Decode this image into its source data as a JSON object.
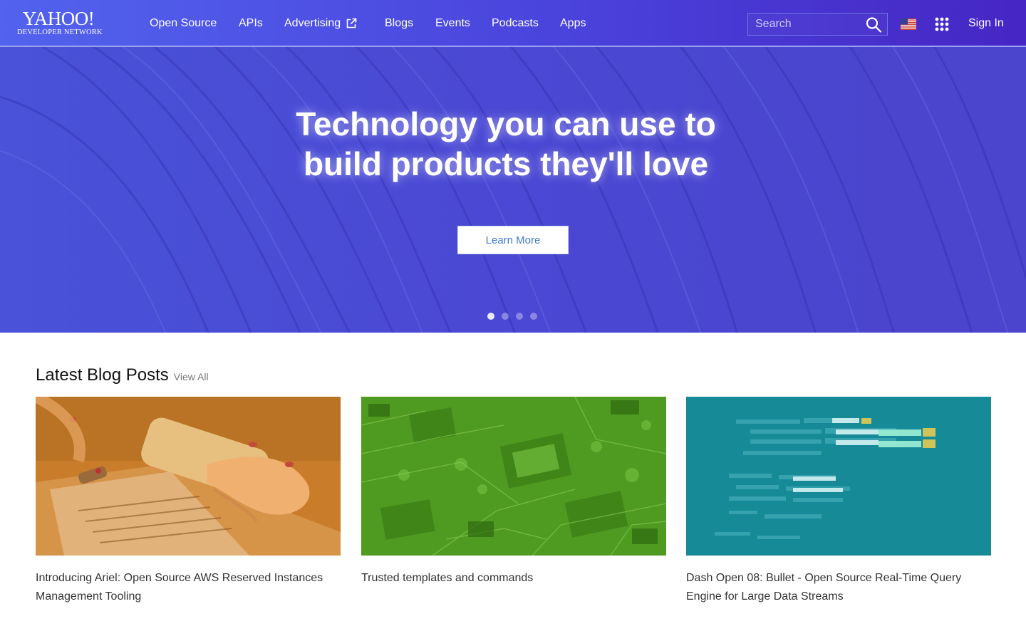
{
  "brand": {
    "logo_main": "YAHOO!",
    "logo_sub": "DEVELOPER NETWORK",
    "primary_color": "#4b4ad2",
    "accent_color": "#3f7ad1"
  },
  "nav": {
    "items": [
      {
        "label": "Open Source"
      },
      {
        "label": "APIs"
      },
      {
        "label": "Advertising",
        "icon": "external-link-icon"
      },
      {
        "label": "Blogs"
      },
      {
        "label": "Events"
      },
      {
        "label": "Podcasts"
      },
      {
        "label": "Apps"
      }
    ]
  },
  "header": {
    "search_placeholder": "Search",
    "search_icon": "search-icon",
    "region_icon": "us-flag-icon",
    "apps_icon": "apps-grid-icon",
    "signin_label": "Sign In"
  },
  "hero": {
    "title_line1": "Technology you can use to",
    "title_line2": "build products they'll love",
    "cta_label": "Learn More",
    "carousel_count": 4,
    "carousel_active": 1
  },
  "blog": {
    "section_title": "Latest Blog Posts",
    "view_all_label": "View All",
    "posts": [
      {
        "title": "Introducing Ariel: Open Source AWS Reserved Instances Management Tooling",
        "image": "phone-laptop-image",
        "tint": "#c87a1e"
      },
      {
        "title": "Trusted templates and commands",
        "image": "circuit-board-image",
        "tint": "#4e9a1f"
      },
      {
        "title": "Dash Open 08: Bullet - Open Source Real-Time Query Engine for Large Data Streams",
        "image": "code-screen-image",
        "tint": "#148896"
      }
    ]
  }
}
